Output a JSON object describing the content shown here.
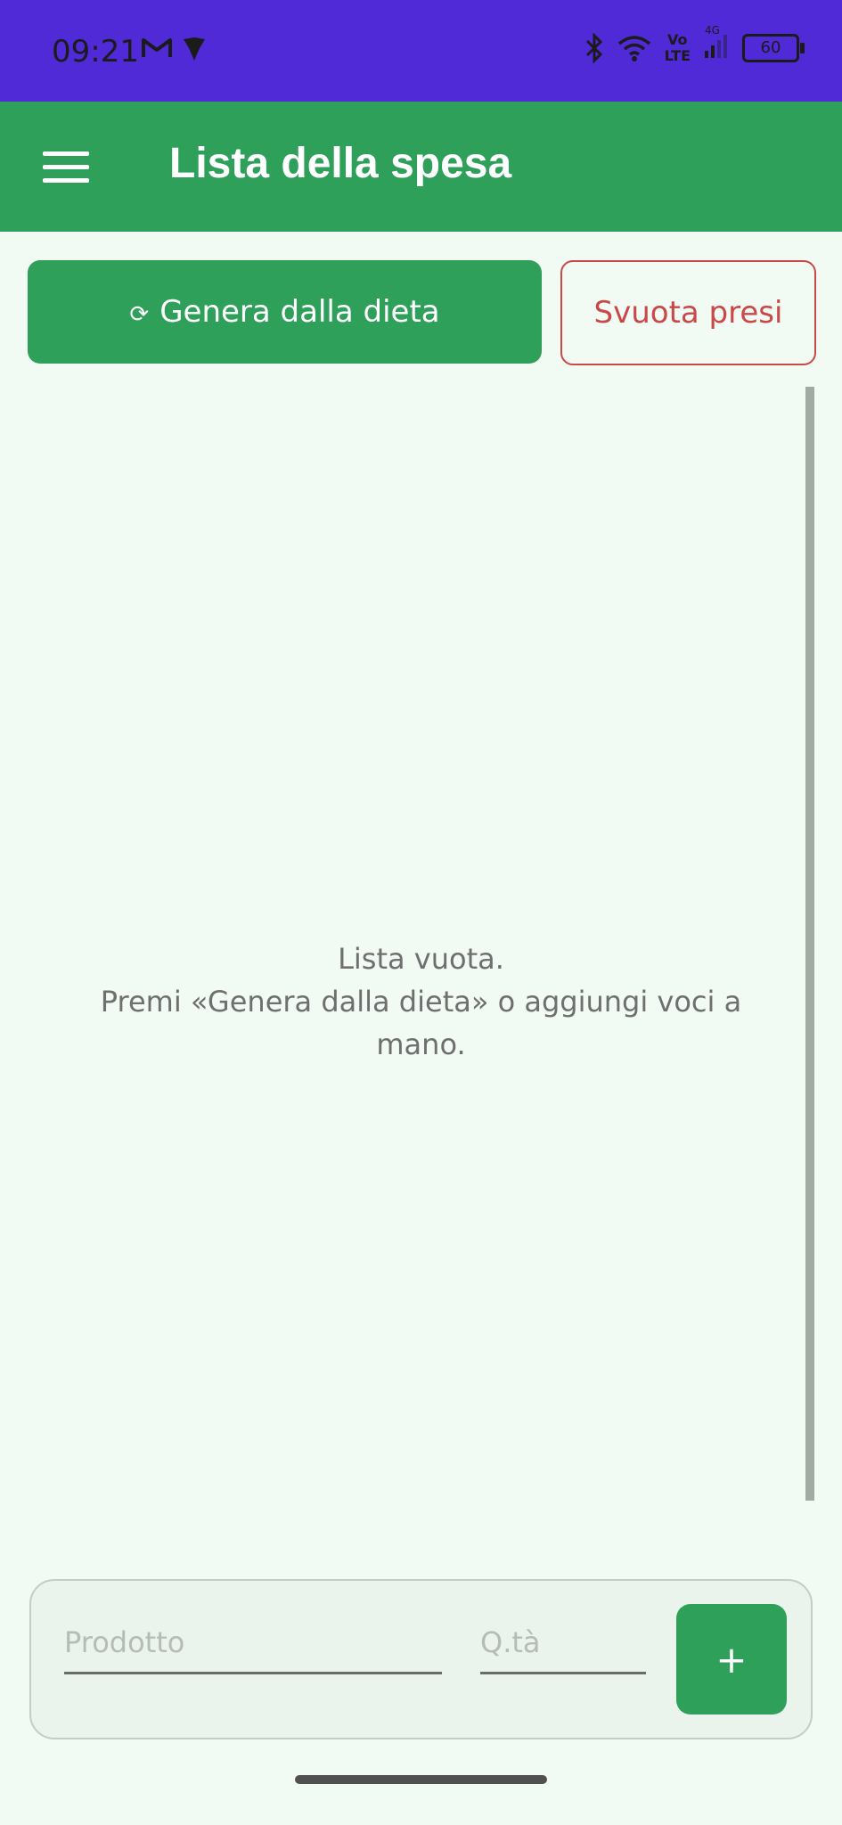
{
  "status_bar": {
    "time": "09:21",
    "network_label_top": "Vo",
    "network_label_bottom": "LTE",
    "network_gen": "4G",
    "battery": "60",
    "icons": [
      "gmail-icon",
      "app-notification-icon",
      "bluetooth-icon",
      "wifi-icon",
      "signal-icon",
      "battery-icon"
    ]
  },
  "app_bar": {
    "title": "Lista della spesa",
    "menu_icon": "hamburger-menu-icon"
  },
  "actions": {
    "generate_icon": "⟳",
    "generate_label": "Genera dalla dieta",
    "clear_label": "Svuota presi"
  },
  "list": {
    "empty_line1": "Lista vuota.",
    "empty_line2": "Premi «Genera dalla dieta» o aggiungi voci a mano."
  },
  "add_form": {
    "product_placeholder": "Prodotto",
    "product_value": "",
    "qty_placeholder": "Q.tà",
    "qty_value": "",
    "add_label": "+"
  },
  "colors": {
    "status_bar": "#4f2ad6",
    "primary": "#2ea05a",
    "danger": "#c94848",
    "background": "#f1faf3"
  }
}
